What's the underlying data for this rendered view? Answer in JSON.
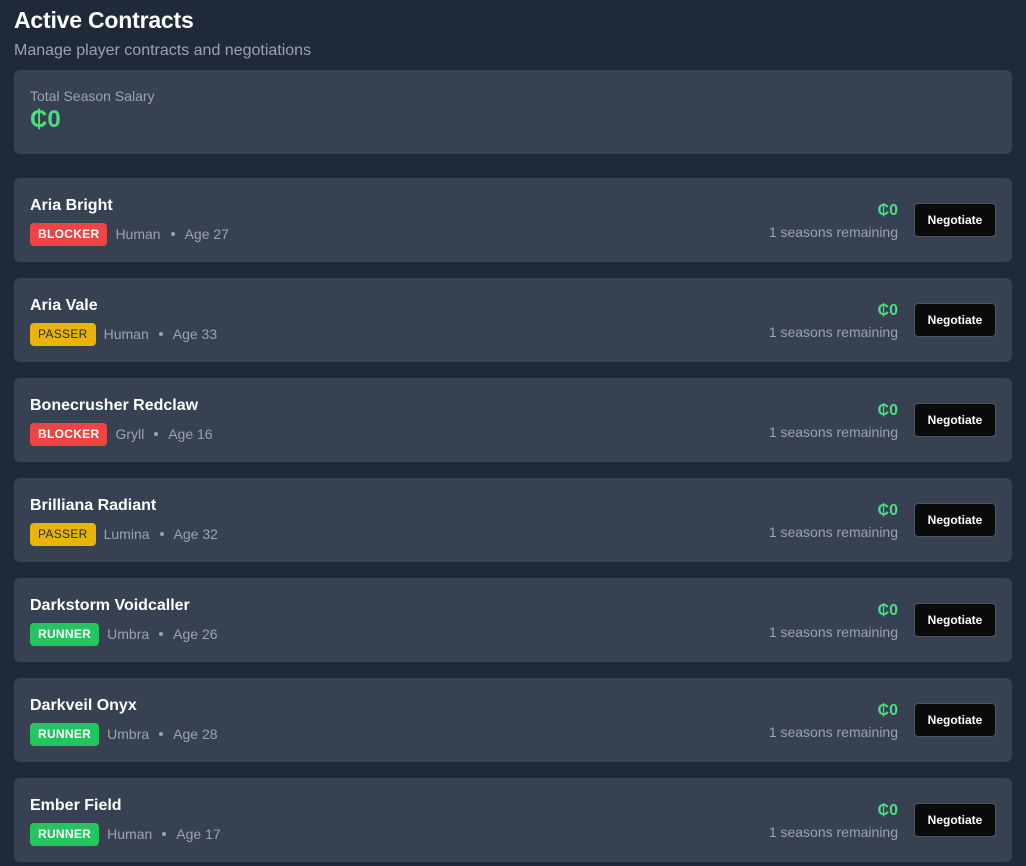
{
  "header": {
    "title": "Active Contracts",
    "subtitle": "Manage player contracts and negotiations"
  },
  "summary": {
    "label": "Total Season Salary",
    "value": "₵0"
  },
  "colors": {
    "blocker": "#ef4444",
    "passer": "#eab308",
    "runner": "#22c55e",
    "salary": "#4ade80"
  },
  "contracts": [
    {
      "name": "Aria Bright",
      "position": "BLOCKER",
      "race": "Human",
      "age": "Age 27",
      "salary": "₵0",
      "seasons": "1 seasons remaining",
      "action": "Negotiate"
    },
    {
      "name": "Aria Vale",
      "position": "PASSER",
      "race": "Human",
      "age": "Age 33",
      "salary": "₵0",
      "seasons": "1 seasons remaining",
      "action": "Negotiate"
    },
    {
      "name": "Bonecrusher Redclaw",
      "position": "BLOCKER",
      "race": "Gryll",
      "age": "Age 16",
      "salary": "₵0",
      "seasons": "1 seasons remaining",
      "action": "Negotiate"
    },
    {
      "name": "Brilliana Radiant",
      "position": "PASSER",
      "race": "Lumina",
      "age": "Age 32",
      "salary": "₵0",
      "seasons": "1 seasons remaining",
      "action": "Negotiate"
    },
    {
      "name": "Darkstorm Voidcaller",
      "position": "RUNNER",
      "race": "Umbra",
      "age": "Age 26",
      "salary": "₵0",
      "seasons": "1 seasons remaining",
      "action": "Negotiate"
    },
    {
      "name": "Darkveil Onyx",
      "position": "RUNNER",
      "race": "Umbra",
      "age": "Age 28",
      "salary": "₵0",
      "seasons": "1 seasons remaining",
      "action": "Negotiate"
    },
    {
      "name": "Ember Field",
      "position": "RUNNER",
      "race": "Human",
      "age": "Age 17",
      "salary": "₵0",
      "seasons": "1 seasons remaining",
      "action": "Negotiate"
    }
  ]
}
